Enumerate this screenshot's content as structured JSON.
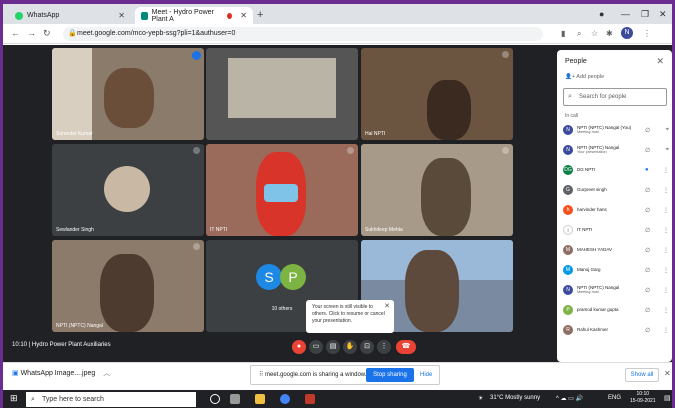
{
  "browser": {
    "tabs": [
      {
        "label": "WhatsApp"
      },
      {
        "label": "Meet - Hydro Power Plant A"
      }
    ],
    "url": "meet.google.com/mco-yepb-ssg?pli=1&authuser=0",
    "profile_initial": "N"
  },
  "meet": {
    "tiles": [
      {
        "name": "Surender Kumar"
      },
      {
        "name": ""
      },
      {
        "name": "Hal NPTI"
      },
      {
        "name": "Sewlander Singh"
      },
      {
        "name": "IT NPTI"
      },
      {
        "name": "Sukhdeep Mehta"
      },
      {
        "name": "NPTI (NPTC) Nangal"
      },
      {
        "name": "10 others"
      },
      {
        "name": ""
      }
    ],
    "others_initials": [
      "S",
      "P"
    ],
    "meeting_info": "10:10  |  Hydro Power Plant Auxiliaries",
    "popup": "Your screen is still visible to others. Click to resume or cancel your presentation.",
    "participant_count": "18"
  },
  "people_panel": {
    "title": "People",
    "add_people": "Add people",
    "search_placeholder": "Search for people",
    "section": "In call",
    "participants": [
      {
        "initial": "N",
        "name": "NPTI (NPTC) Nangal (You)",
        "sub": "Meeting host",
        "color": "#3c4a9e"
      },
      {
        "initial": "N",
        "name": "NPTI (NPTC) Nangal",
        "sub": "Your presentation",
        "color": "#3c4a9e"
      },
      {
        "initial": "DG",
        "name": "DG NPTI",
        "sub": "",
        "color": "#0b8043"
      },
      {
        "initial": "G",
        "name": "Gurpreet singh",
        "sub": "",
        "color": "#5f6368"
      },
      {
        "initial": "h",
        "name": "harvinder hans",
        "sub": "",
        "color": "#f4511e"
      },
      {
        "initial": "i",
        "name": "IT NPTI",
        "sub": "",
        "color": "#ffffff"
      },
      {
        "initial": "M",
        "name": "MAHESH YADAV",
        "sub": "",
        "color": "#8d6e63"
      },
      {
        "initial": "M",
        "name": "Manoj Garg",
        "sub": "",
        "color": "#039be5"
      },
      {
        "initial": "N",
        "name": "NPTI (NPTC) Nangal",
        "sub": "Meeting host",
        "color": "#3c4a9e"
      },
      {
        "initial": "P",
        "name": "pramod kumar gupta",
        "sub": "",
        "color": "#7cb342"
      },
      {
        "initial": "R",
        "name": "Rahul Kashmer",
        "sub": "",
        "color": "#8d6e63"
      }
    ]
  },
  "downloads": {
    "item": "WhatsApp Image....jpeg",
    "sharing_text": "meet.google.com is sharing a window.",
    "stop_label": "Stop sharing",
    "hide_label": "Hide",
    "show_all_label": "Show all"
  },
  "taskbar": {
    "search_placeholder": "Type here to search",
    "weather": "31°C  Mostly sunny",
    "lang": "ENG",
    "time": "10:10",
    "date": "15-09-2021"
  }
}
